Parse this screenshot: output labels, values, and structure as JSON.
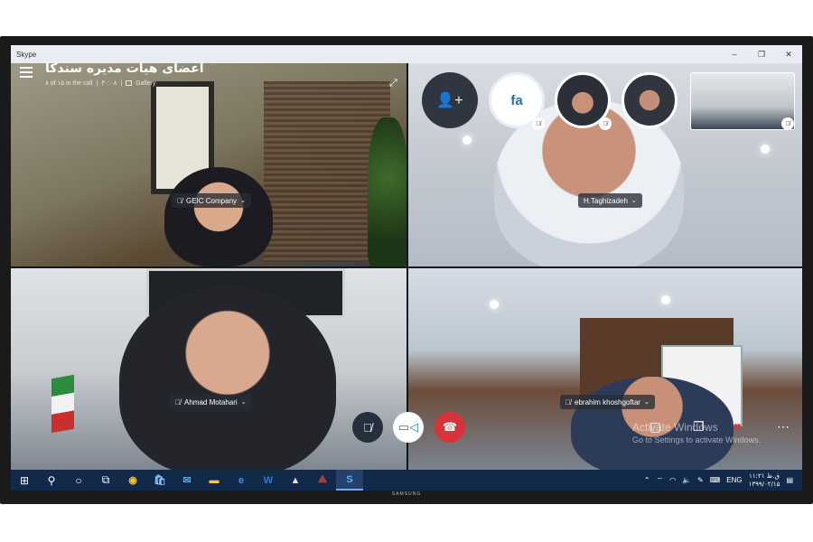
{
  "window": {
    "app_name": "Skype",
    "controls": [
      "–",
      "❐",
      "✕"
    ]
  },
  "call": {
    "title": "اعضای هیات مدیره سندکا",
    "participants_info": "۸ of ۱۵ in the call",
    "duration": "۳۰:۰۸",
    "view_label": "Gallery"
  },
  "participants": [
    {
      "name": "GEIC Company",
      "muted": true
    },
    {
      "name": "H.Taghizadeh",
      "muted": false
    },
    {
      "name": "Ahmad Motahari",
      "muted": true
    },
    {
      "name": "ebrahim khoshgoftar",
      "muted": true
    }
  ],
  "roster": {
    "add_icon": "add-person-icon",
    "initials": "fa"
  },
  "controls": {
    "mute_icon": "mic-off-icon",
    "video_icon": "video-icon",
    "hangup_icon": "hangup-icon"
  },
  "watermark": {
    "line1": "Activate Windows",
    "line2": "Go to Settings to activate Windows."
  },
  "taskbar": {
    "language": "ENG",
    "time": "۱۱:۲۱ ق.ظ",
    "date": "۱۳۹۹/۰۲/۱۵"
  },
  "monitor_brand": "SAMSUNG",
  "colors": {
    "hangup": "#d8333b",
    "video": "#0f7cc5",
    "taskbar": "#13294a"
  }
}
